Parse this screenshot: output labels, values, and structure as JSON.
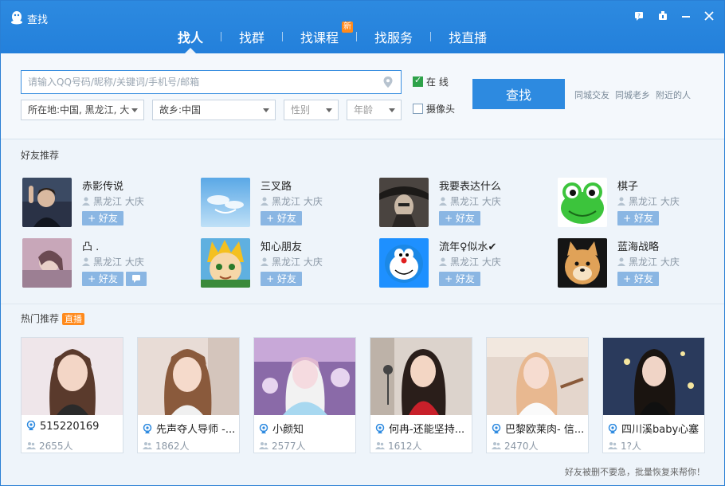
{
  "window": {
    "title": "查找"
  },
  "tabs": [
    {
      "label": "找人",
      "active": true
    },
    {
      "label": "找群"
    },
    {
      "label": "找课程",
      "badge": "新"
    },
    {
      "label": "找服务"
    },
    {
      "label": "找直播"
    }
  ],
  "search": {
    "placeholder": "请输入QQ号码/昵称/关键词/手机号/邮箱",
    "location": "所在地:中国, 黑龙江, 大",
    "hometown": "故乡:中国",
    "gender": "性别",
    "age": "年龄",
    "online_label": "在 线",
    "online_checked": true,
    "camera_label": "摄像头",
    "camera_checked": false,
    "find_button": "查找",
    "quick_links": [
      "同城交友",
      "同城老乡",
      "附近的人"
    ]
  },
  "friends_section": {
    "title": "好友推荐",
    "add_label": "+ 好友",
    "items": [
      {
        "name": "赤影传说",
        "location": "黑龙江 大庆"
      },
      {
        "name": "三叉路",
        "location": "黑龙江 大庆"
      },
      {
        "name": "我要表达什么",
        "location": "黑龙江 大庆"
      },
      {
        "name": "棋子",
        "location": "黑龙江 大庆"
      },
      {
        "name": "凸 .",
        "location": "黑龙江 大庆"
      },
      {
        "name": "知心朋友",
        "location": "黑龙江 大庆"
      },
      {
        "name": "流年♀似水✔",
        "location": "黑龙江 大庆"
      },
      {
        "name": "蓝海战略",
        "location": "黑龙江 大庆"
      }
    ]
  },
  "hot_section": {
    "title": "热门推荐",
    "badge": "直播",
    "items": [
      {
        "name": "515220169",
        "count": "2655人"
      },
      {
        "name": "先声夺人导师 -...",
        "count": "1862人"
      },
      {
        "name": "小颜知",
        "count": "2577人"
      },
      {
        "name": "何冉-还能坚持...",
        "count": "1612人"
      },
      {
        "name": "巴黎欧莱肉- 信...",
        "count": "2470人"
      },
      {
        "name": "四川溪baby心塞",
        "count": "1?人"
      }
    ]
  },
  "footer_tip": "好友被删不要急，批量恢复来帮你！",
  "colors": {
    "accent": "#2d8ae0",
    "badge": "#ff8a1c",
    "add_button": "#8ab6e3"
  }
}
